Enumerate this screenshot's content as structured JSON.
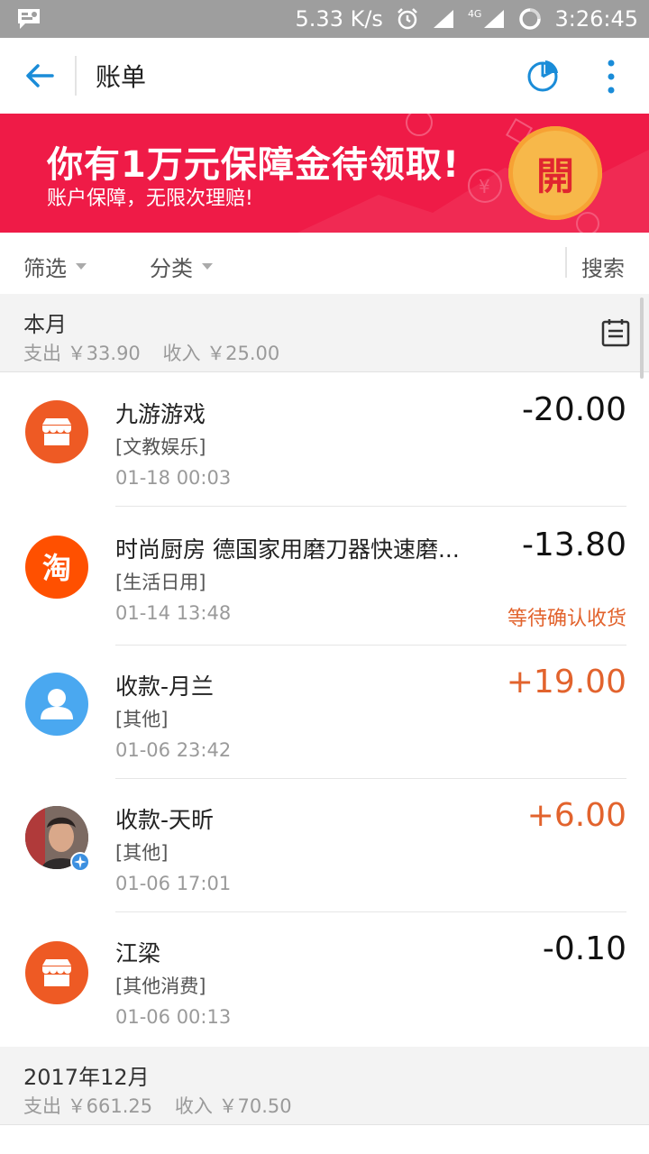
{
  "status_bar": {
    "speed": "5.33 K/s",
    "network": "4G",
    "time": "3:26:45"
  },
  "app_bar": {
    "title": "账单"
  },
  "banner": {
    "headline": "你有1万元保障金待领取!",
    "subtitle": "账户保障，无限次理赔!",
    "button": "開"
  },
  "filters": {
    "filter": "筛选",
    "category": "分类",
    "search": "搜索"
  },
  "sections": [
    {
      "month": "本月",
      "expense": "支出 ￥33.90",
      "income": "收入 ￥25.00"
    },
    {
      "month": "2017年12月",
      "expense": "支出 ￥661.25",
      "income": "收入 ￥70.50"
    }
  ],
  "transactions": [
    {
      "name": "九游游戏",
      "category": "[文教娱乐]",
      "time": "01-18  00:03",
      "amount": "-20.00",
      "status": "",
      "avatar": "store-icon"
    },
    {
      "name": "时尚厨房 德国家用磨刀器快速磨...",
      "category": "[生活日用]",
      "time": "01-14  13:48",
      "amount": "-13.80",
      "status": "等待确认收货",
      "avatar": "taobao-icon"
    },
    {
      "name": "收款-月兰",
      "category": "[其他]",
      "time": "01-06  23:42",
      "amount": "+19.00",
      "status": "",
      "avatar": "person-icon"
    },
    {
      "name": "收款-天昕",
      "category": "[其他]",
      "time": "01-06  17:01",
      "amount": "+6.00",
      "status": "",
      "avatar": "user-photo"
    },
    {
      "name": "江梁",
      "category": "[其他消费]",
      "time": "01-06  00:13",
      "amount": "-0.10",
      "status": "",
      "avatar": "store-icon"
    }
  ],
  "colors": {
    "accent": "#1a8cd8",
    "banner": "#ef1b47",
    "income": "#e2632d",
    "store": "#ee5a24"
  }
}
